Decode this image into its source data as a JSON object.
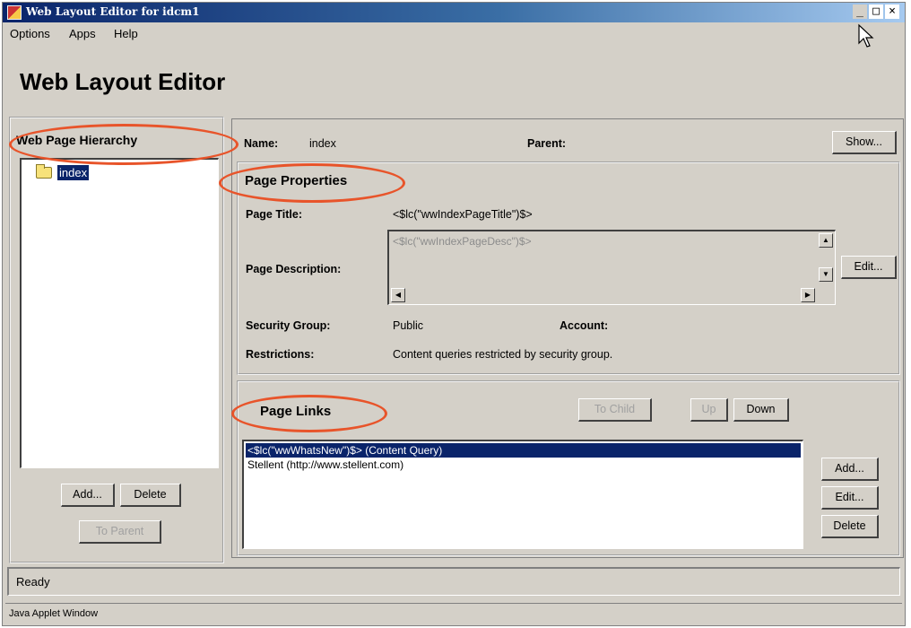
{
  "window": {
    "title": "Web Layout Editor for idcm1",
    "controls": {
      "minimize": "_",
      "maximize": "□",
      "close": "×"
    }
  },
  "menu": {
    "items": [
      "Options",
      "Apps",
      "Help"
    ]
  },
  "app_title": "Web Layout Editor",
  "hierarchy": {
    "heading": "Web Page Hierarchy",
    "tree": [
      {
        "label": "index",
        "icon": "folder-icon",
        "selected": true
      }
    ],
    "buttons": {
      "add": "Add...",
      "delete": "Delete",
      "to_parent": "To Parent"
    }
  },
  "page_info": {
    "name_label": "Name:",
    "name_value": "index",
    "parent_label": "Parent:",
    "show_button": "Show..."
  },
  "properties": {
    "heading": "Page Properties",
    "title_label": "Page Title:",
    "title_value": "<$lc(\"wwIndexPageTitle\")$>",
    "description_label": "Page Description:",
    "description_value": "<$lc(\"wwIndexPageDesc\")$>",
    "edit_button": "Edit...",
    "security_label": "Security Group:",
    "security_value": "Public",
    "account_label": "Account:",
    "restrictions_label": "Restrictions:",
    "restrictions_value": "Content queries restricted by security group."
  },
  "links": {
    "heading": "Page Links",
    "buttons": {
      "to_child": "To Child",
      "up": "Up",
      "down": "Down",
      "add": "Add...",
      "edit": "Edit...",
      "delete": "Delete"
    },
    "items": [
      {
        "label": "<$lc(\"wwWhatsNew\")$> (Content Query)",
        "selected": true
      },
      {
        "label": "Stellent (http://www.stellent.com)",
        "selected": false
      }
    ]
  },
  "status": {
    "text": "Ready"
  },
  "applet_label": "Java Applet Window",
  "colors": {
    "annotation": "#e8542a",
    "selection": "#0a246a",
    "window_bg": "#d4d0c8"
  }
}
